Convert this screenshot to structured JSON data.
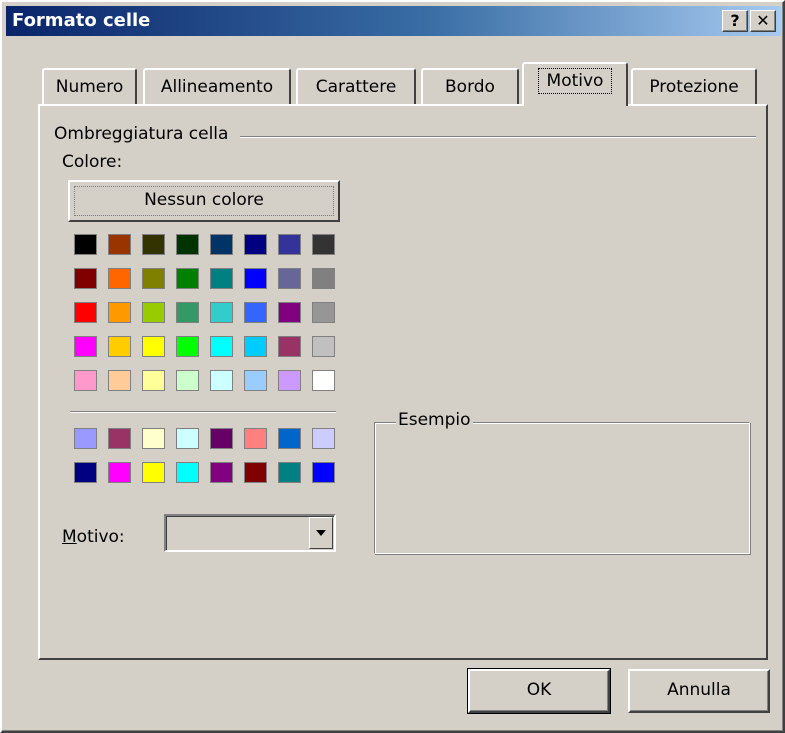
{
  "window": {
    "title": "Formato celle",
    "help_label": "?",
    "close_label": "✕"
  },
  "tabs": [
    {
      "label": "Numero",
      "active": false
    },
    {
      "label": "Allineamento",
      "active": false
    },
    {
      "label": "Carattere",
      "active": false
    },
    {
      "label": "Bordo",
      "active": false
    },
    {
      "label": "Motivo",
      "active": true
    },
    {
      "label": "Protezione",
      "active": false
    }
  ],
  "shading": {
    "legend": "Ombreggiatura cella",
    "color_label": "Colore:",
    "no_color_label": "Nessun colore"
  },
  "palette": {
    "main": [
      [
        "#000000",
        "#993300",
        "#333300",
        "#003300",
        "#003366",
        "#000080",
        "#333399",
        "#333333"
      ],
      [
        "#800000",
        "#ff6600",
        "#808000",
        "#008000",
        "#008080",
        "#0000ff",
        "#666699",
        "#808080"
      ],
      [
        "#ff0000",
        "#ff9900",
        "#99cc00",
        "#339966",
        "#33cccc",
        "#3366ff",
        "#800080",
        "#969696"
      ],
      [
        "#ff00ff",
        "#ffcc00",
        "#ffff00",
        "#00ff00",
        "#00ffff",
        "#00ccff",
        "#993366",
        "#c0c0c0"
      ],
      [
        "#ff99cc",
        "#ffcc99",
        "#ffff99",
        "#ccffcc",
        "#ccffff",
        "#99ccff",
        "#cc99ff",
        "#ffffff"
      ]
    ],
    "extra": [
      [
        "#9999ff",
        "#993366",
        "#ffffcc",
        "#ccffff",
        "#660066",
        "#ff8080",
        "#0066cc",
        "#ccccff"
      ],
      [
        "#000080",
        "#ff00ff",
        "#ffff00",
        "#00ffff",
        "#800080",
        "#800000",
        "#008080",
        "#0000ff"
      ]
    ]
  },
  "pattern": {
    "label_underlined": "M",
    "label_rest": "otivo:",
    "value": ""
  },
  "example": {
    "legend": "Esempio"
  },
  "buttons": {
    "ok": "OK",
    "cancel": "Annulla"
  }
}
